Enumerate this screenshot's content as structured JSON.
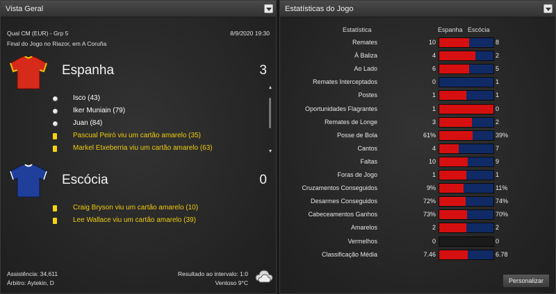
{
  "left_panel": {
    "title": "Vista Geral",
    "competition": "Qual CM (EUR) - Grp 5",
    "datetime": "8/9/2020 19:30",
    "venue": "Final do Jogo no Riazor, em A Coruña",
    "home": {
      "name": "Espanha",
      "score": "3",
      "shirt_color": "#d62a1a",
      "events": [
        {
          "icon": "ball-icon",
          "text": "Isco (43)",
          "highlight": false
        },
        {
          "icon": "ball-icon",
          "text": "Iker Muniain (79)",
          "highlight": false
        },
        {
          "icon": "ball-icon",
          "text": "Juan (84)",
          "highlight": false
        },
        {
          "icon": "yellow-card-icon",
          "text": "Pascual Peiró viu um cartão amarelo (35)",
          "highlight": true
        },
        {
          "icon": "yellow-card-icon",
          "text": "Markel Etxeberria viu um cartão amarelo (63)",
          "highlight": true
        }
      ]
    },
    "away": {
      "name": "Escócia",
      "score": "0",
      "shirt_color": "#1f3f9a",
      "events": [
        {
          "icon": "yellow-card-icon",
          "text": "Craig Bryson viu um cartão amarelo (10)",
          "highlight": true
        },
        {
          "icon": "yellow-card-icon",
          "text": "Lee Wallace viu um cartão amarelo (39)",
          "highlight": true
        }
      ]
    },
    "footer": {
      "attendance": "Assistência: 34,611",
      "referee": "Árbitro: Aytekin, D",
      "halftime": "Resultado ao intervalo: 1:0",
      "weather": "Ventoso 9°C",
      "weather_icon": "cloudy-weather-icon"
    }
  },
  "right_panel": {
    "title": "Estatísticas do Jogo",
    "header": {
      "stat": "Estatística",
      "home": "Espanha",
      "away": "Escócia"
    },
    "colors": {
      "home": "#d61010",
      "away": "#102a66"
    },
    "stats": [
      {
        "label": "Remates",
        "home": "10",
        "away": "8",
        "home_share": 0.556
      },
      {
        "label": "À Baliza",
        "home": "4",
        "away": "2",
        "home_share": 0.667
      },
      {
        "label": "Ao Lado",
        "home": "6",
        "away": "5",
        "home_share": 0.545
      },
      {
        "label": "Remates Interceptados",
        "home": "0",
        "away": "1",
        "home_share": 0.0
      },
      {
        "label": "Postes",
        "home": "1",
        "away": "1",
        "home_share": 0.5
      },
      {
        "label": "Oportunidades Flagrantes",
        "home": "1",
        "away": "0",
        "home_share": 1.0
      },
      {
        "label": "Remates de Longe",
        "home": "3",
        "away": "2",
        "home_share": 0.6
      },
      {
        "label": "Posse de Bola",
        "home": "61%",
        "away": "39%",
        "home_share": 0.61
      },
      {
        "label": "Cantos",
        "home": "4",
        "away": "7",
        "home_share": 0.364
      },
      {
        "label": "Faltas",
        "home": "10",
        "away": "9",
        "home_share": 0.526
      },
      {
        "label": "Foras de Jogo",
        "home": "1",
        "away": "1",
        "home_share": 0.5
      },
      {
        "label": "Cruzamentos Conseguidos",
        "home": "9%",
        "away": "11%",
        "home_share": 0.45
      },
      {
        "label": "Desarmes Conseguidos",
        "home": "72%",
        "away": "74%",
        "home_share": 0.493
      },
      {
        "label": "Cabeceamentos Ganhos",
        "home": "73%",
        "away": "70%",
        "home_share": 0.51
      },
      {
        "label": "Amarelos",
        "home": "2",
        "away": "2",
        "home_share": 0.5
      },
      {
        "label": "Vermelhos",
        "home": "0",
        "away": "0",
        "home_share": null
      },
      {
        "label": "Classificação Média",
        "home": "7.46",
        "away": "6.78",
        "home_share": 0.524
      }
    ],
    "customize_label": "Personalizar"
  }
}
